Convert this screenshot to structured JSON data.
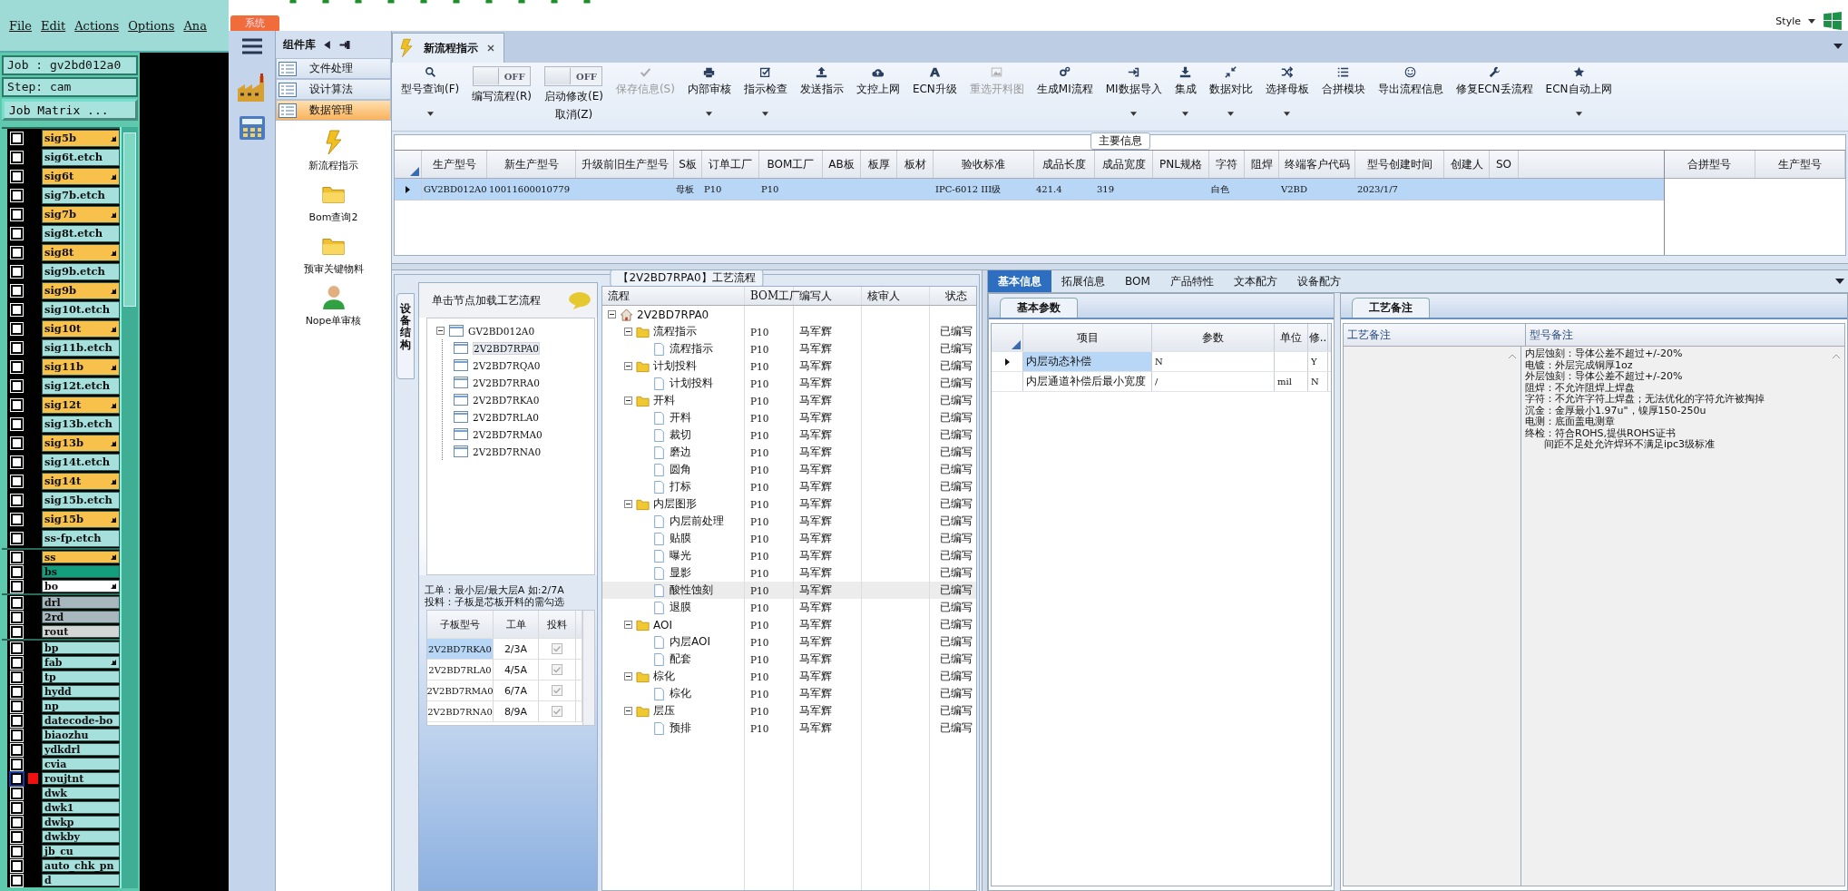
{
  "left_app": {
    "menu": [
      "File",
      "Edit",
      "Actions",
      "Options",
      "Ana"
    ],
    "job": "Job : gv2bd012a0",
    "step": "Step: cam",
    "matrix_button": "Job Matrix ...",
    "layer_groups": [
      {
        "compact": false,
        "layers": [
          {
            "name": "sig5b",
            "kind": "signal",
            "flag": true,
            "selected": false
          },
          {
            "name": "sig6t.etch",
            "kind": "etch",
            "flag": false,
            "selected": false
          },
          {
            "name": "sig6t",
            "kind": "signal",
            "flag": true,
            "selected": false
          },
          {
            "name": "sig7b.etch",
            "kind": "etch",
            "flag": false,
            "selected": false
          },
          {
            "name": "sig7b",
            "kind": "signal",
            "flag": true,
            "selected": false
          },
          {
            "name": "sig8t.etch",
            "kind": "etch",
            "flag": false,
            "selected": false
          },
          {
            "name": "sig8t",
            "kind": "signal",
            "flag": true,
            "selected": false
          },
          {
            "name": "sig9b.etch",
            "kind": "etch",
            "flag": false,
            "selected": false
          },
          {
            "name": "sig9b",
            "kind": "signal",
            "flag": true,
            "selected": false
          },
          {
            "name": "sig10t.etch",
            "kind": "etch",
            "flag": false,
            "selected": false
          },
          {
            "name": "sig10t",
            "kind": "signal",
            "flag": true,
            "selected": false
          },
          {
            "name": "sig11b.etch",
            "kind": "etch",
            "flag": false,
            "selected": false
          },
          {
            "name": "sig11b",
            "kind": "signal",
            "flag": true,
            "selected": false
          },
          {
            "name": "sig12t.etch",
            "kind": "etch",
            "flag": false,
            "selected": false
          },
          {
            "name": "sig12t",
            "kind": "signal",
            "flag": true,
            "selected": false
          },
          {
            "name": "sig13b.etch",
            "kind": "etch",
            "flag": false,
            "selected": false
          },
          {
            "name": "sig13b",
            "kind": "signal",
            "flag": true,
            "selected": false
          },
          {
            "name": "sig14t.etch",
            "kind": "etch",
            "flag": false,
            "selected": false
          },
          {
            "name": "sig14t",
            "kind": "signal",
            "flag": true,
            "selected": false
          },
          {
            "name": "sig15b.etch",
            "kind": "etch",
            "flag": false,
            "selected": false
          },
          {
            "name": "sig15b",
            "kind": "signal",
            "flag": true,
            "selected": false
          },
          {
            "name": "ss-fp.etch",
            "kind": "etch",
            "flag": false,
            "selected": false
          }
        ]
      },
      {
        "compact": true,
        "layers": [
          {
            "name": "ss",
            "kind": "signal",
            "flag": true,
            "selected": false
          },
          {
            "name": "bs",
            "kind": "mask",
            "flag": false,
            "selected": false
          },
          {
            "name": "bo",
            "kind": "silk",
            "flag": true,
            "selected": false
          }
        ]
      },
      {
        "compact": true,
        "layers": [
          {
            "name": "drl",
            "kind": "drill",
            "flag": false,
            "selected": false
          },
          {
            "name": "2rd",
            "kind": "drill",
            "flag": false,
            "selected": false
          },
          {
            "name": "rout",
            "kind": "rout",
            "flag": false,
            "selected": false
          }
        ]
      },
      {
        "compact": true,
        "layers": [
          {
            "name": "bp",
            "kind": "doc",
            "flag": false,
            "selected": false
          },
          {
            "name": "fab",
            "kind": "doc",
            "flag": true,
            "selected": false
          },
          {
            "name": "tp",
            "kind": "doc",
            "flag": false,
            "selected": false
          },
          {
            "name": "hydd",
            "kind": "doc",
            "flag": false,
            "selected": false
          },
          {
            "name": "np",
            "kind": "doc",
            "flag": false,
            "selected": false
          },
          {
            "name": "datecode-bo",
            "kind": "doc",
            "flag": false,
            "selected": false
          },
          {
            "name": "biaozhu",
            "kind": "doc",
            "flag": false,
            "selected": false
          },
          {
            "name": "ydkdrl",
            "kind": "doc",
            "flag": false,
            "selected": false
          },
          {
            "name": "cvia",
            "kind": "doc",
            "flag": false,
            "selected": false
          },
          {
            "name": "roujtnt",
            "kind": "doc",
            "flag": false,
            "selected": true
          },
          {
            "name": "dwk",
            "kind": "doc",
            "flag": false,
            "selected": false
          },
          {
            "name": "dwk1",
            "kind": "doc",
            "flag": false,
            "selected": false
          },
          {
            "name": "dwkp",
            "kind": "doc",
            "flag": false,
            "selected": false
          },
          {
            "name": "dwkby",
            "kind": "doc",
            "flag": false,
            "selected": false
          },
          {
            "name": "jb_cu",
            "kind": "doc",
            "flag": false,
            "selected": false
          },
          {
            "name": "auto_chk_pn",
            "kind": "doc",
            "flag": false,
            "selected": false
          },
          {
            "name": "d",
            "kind": "doc",
            "flag": false,
            "selected": false
          }
        ]
      }
    ]
  },
  "app": {
    "system_tab": "系统",
    "style": "Style",
    "nav_header": "组件库",
    "nav_items": [
      {
        "label": "文件处理",
        "selected": false
      },
      {
        "label": "设计算法",
        "selected": false
      },
      {
        "label": "数据管理",
        "selected": true
      }
    ],
    "nav_tools": [
      {
        "label": "新流程指示",
        "kind": "bolt"
      },
      {
        "label": "Bom查询2",
        "kind": "folder"
      },
      {
        "label": "预审关键物料",
        "kind": "folder"
      },
      {
        "label": "Nope单审核",
        "kind": "person"
      }
    ],
    "doc_tab": "新流程指示",
    "ribbon": [
      {
        "kind": "button",
        "label": "型号查询(F)",
        "dropdown": true,
        "disabled": false
      },
      {
        "kind": "toggle",
        "toggle": "OFF",
        "label": "编写流程(R)"
      },
      {
        "kind": "toggle",
        "toggle": "OFF",
        "label": "启动修改(E)",
        "label2": "取消(Z)"
      },
      {
        "kind": "button",
        "label": "保存信息(S)",
        "dropdown": false,
        "disabled": true
      },
      {
        "kind": "button",
        "label": "内部审核",
        "dropdown": true,
        "disabled": false
      },
      {
        "kind": "button",
        "label": "指示检查",
        "dropdown": true,
        "disabled": false
      },
      {
        "kind": "button",
        "label": "发送指示",
        "dropdown": false,
        "disabled": false
      },
      {
        "kind": "button",
        "label": "文控上网",
        "dropdown": false,
        "disabled": false
      },
      {
        "kind": "button",
        "label": "ECN升级",
        "dropdown": false,
        "disabled": false
      },
      {
        "kind": "button",
        "label": "重选开料图",
        "dropdown": false,
        "disabled": true
      },
      {
        "kind": "button",
        "label": "生成MI流程",
        "dropdown": false,
        "disabled": false
      },
      {
        "kind": "button",
        "label": "MI数据导入",
        "dropdown": true,
        "disabled": false
      },
      {
        "kind": "button",
        "label": "集成",
        "dropdown": true,
        "disabled": false
      },
      {
        "kind": "button",
        "label": "数据对比",
        "dropdown": true,
        "disabled": false
      },
      {
        "kind": "button",
        "label": "选择母板",
        "dropdown": true,
        "disabled": false
      },
      {
        "kind": "button",
        "label": "合拼模块",
        "dropdown": false,
        "disabled": false
      },
      {
        "kind": "button",
        "label": "导出流程信息",
        "dropdown": false,
        "disabled": false
      },
      {
        "kind": "button",
        "label": "修复ECN丢流程",
        "dropdown": false,
        "disabled": false
      },
      {
        "kind": "button",
        "label": "ECN自动上网",
        "dropdown": true,
        "disabled": false
      }
    ]
  },
  "main_info": {
    "title": "主要信息",
    "columns": [
      "生产型号",
      "新生产型号",
      "升级前旧生产型号",
      "S板",
      "订单工厂",
      "BOM工厂",
      "AB板",
      "板厚",
      "板材",
      "验收标准",
      "成品长度",
      "成品宽度",
      "PNL规格",
      "字符",
      "阻焊",
      "终端客户代码",
      "型号创建时间",
      "创建人",
      "SO"
    ],
    "rows": [
      {
        "selected": true,
        "cells": [
          "GV2BD012A0",
          "10011600010779",
          "",
          "母板",
          "P10",
          "P10",
          "",
          "",
          "",
          "IPC-6012 III级",
          "421.4",
          "319",
          "",
          "白色",
          "",
          "V2BD",
          "2023/1/7",
          "",
          ""
        ]
      }
    ],
    "merge_columns": [
      "合拼型号",
      "生产型号"
    ]
  },
  "process": {
    "title": "【2V2BD7RPA0】工艺流程",
    "side_tab": "设备结构",
    "hint_header": "单击节点加载工艺流程",
    "board_tree": {
      "label": "GV2BD012A0",
      "expanded": true,
      "children": [
        {
          "label": "2V2BD7RPA0",
          "selected": true
        },
        {
          "label": "2V2BD7RQA0",
          "selected": false
        },
        {
          "label": "2V2BD7RRA0",
          "selected": false
        },
        {
          "label": "2V2BD7RKA0",
          "selected": false
        },
        {
          "label": "2V2BD7RLA0",
          "selected": false
        },
        {
          "label": "2V2BD7RMA0",
          "selected": false
        },
        {
          "label": "2V2BD7RNA0",
          "selected": false
        }
      ]
    },
    "notes": [
      "工单：最小层/最大层A 如:2/7A",
      "投料：子板是芯板开料的需勾选"
    ],
    "sub_table": {
      "columns": [
        "子板型号",
        "工单",
        "投料"
      ],
      "rows": [
        {
          "cells": [
            "2V2BD7RKA0",
            "2/3A"
          ],
          "checked": true,
          "selected": true
        },
        {
          "cells": [
            "2V2BD7RLA0",
            "4/5A"
          ],
          "checked": true,
          "selected": false
        },
        {
          "cells": [
            "2V2BD7RMA0",
            "6/7A"
          ],
          "checked": true,
          "selected": false
        },
        {
          "cells": [
            "2V2BD7RNA0",
            "8/9A"
          ],
          "checked": true,
          "selected": false
        }
      ]
    },
    "flow_columns": [
      "流程",
      "BOM工厂",
      "编写人",
      "核审人",
      "状态"
    ],
    "flow_root": {
      "label": "2V2BD7RPA0",
      "kind": "home",
      "expanded": true,
      "selected": false,
      "children": [
        {
          "label": "流程指示",
          "kind": "folder",
          "expanded": true,
          "factory": "P10",
          "writer": "马军辉",
          "status": "已编写",
          "selected": false,
          "children": [
            {
              "label": "流程指示",
              "kind": "file",
              "factory": "P10",
              "writer": "马军辉",
              "status": "已编写",
              "selected": false
            }
          ]
        },
        {
          "label": "计划投料",
          "kind": "folder",
          "expanded": true,
          "factory": "P10",
          "writer": "马军辉",
          "status": "已编写",
          "selected": false,
          "children": [
            {
              "label": "计划投料",
              "kind": "file",
              "factory": "P10",
              "writer": "马军辉",
              "status": "已编写",
              "selected": false
            }
          ]
        },
        {
          "label": "开料",
          "kind": "folder",
          "expanded": true,
          "factory": "P10",
          "writer": "马军辉",
          "status": "已编写",
          "selected": false,
          "children": [
            {
              "label": "开料",
              "kind": "file",
              "factory": "P10",
              "writer": "马军辉",
              "status": "已编写",
              "selected": false
            },
            {
              "label": "裁切",
              "kind": "file",
              "factory": "P10",
              "writer": "马军辉",
              "status": "已编写",
              "selected": false
            },
            {
              "label": "磨边",
              "kind": "file",
              "factory": "P10",
              "writer": "马军辉",
              "status": "已编写",
              "selected": false
            },
            {
              "label": "圆角",
              "kind": "file",
              "factory": "P10",
              "writer": "马军辉",
              "status": "已编写",
              "selected": false
            },
            {
              "label": "打标",
              "kind": "file",
              "factory": "P10",
              "writer": "马军辉",
              "status": "已编写",
              "selected": false
            }
          ]
        },
        {
          "label": "内层图形",
          "kind": "folder",
          "expanded": true,
          "factory": "P10",
          "writer": "马军辉",
          "status": "已编写",
          "selected": false,
          "children": [
            {
              "label": "内层前处理",
              "kind": "file",
              "factory": "P10",
              "writer": "马军辉",
              "status": "已编写",
              "selected": false
            },
            {
              "label": "贴膜",
              "kind": "file",
              "factory": "P10",
              "writer": "马军辉",
              "status": "已编写",
              "selected": false
            },
            {
              "label": "曝光",
              "kind": "file",
              "factory": "P10",
              "writer": "马军辉",
              "status": "已编写",
              "selected": false
            },
            {
              "label": "显影",
              "kind": "file",
              "factory": "P10",
              "writer": "马军辉",
              "status": "已编写",
              "selected": false
            },
            {
              "label": "酸性蚀刻",
              "kind": "file",
              "factory": "P10",
              "writer": "马军辉",
              "status": "已编写",
              "selected": true
            },
            {
              "label": "退膜",
              "kind": "file",
              "factory": "P10",
              "writer": "马军辉",
              "status": "已编写",
              "selected": false
            }
          ]
        },
        {
          "label": "AOI",
          "kind": "folder",
          "expanded": true,
          "factory": "P10",
          "writer": "马军辉",
          "status": "已编写",
          "selected": false,
          "children": [
            {
              "label": "内层AOI",
              "kind": "file",
              "factory": "P10",
              "writer": "马军辉",
              "status": "已编写",
              "selected": false
            },
            {
              "label": "配套",
              "kind": "file",
              "factory": "P10",
              "writer": "马军辉",
              "status": "已编写",
              "selected": false
            }
          ]
        },
        {
          "label": "棕化",
          "kind": "folder",
          "expanded": true,
          "factory": "P10",
          "writer": "马军辉",
          "status": "已编写",
          "selected": false,
          "children": [
            {
              "label": "棕化",
              "kind": "file",
              "factory": "P10",
              "writer": "马军辉",
              "status": "已编写",
              "selected": false
            }
          ]
        },
        {
          "label": "层压",
          "kind": "folder",
          "expanded": true,
          "factory": "P10",
          "writer": "马军辉",
          "status": "已编写",
          "selected": false,
          "children": [
            {
              "label": "预排",
              "kind": "file",
              "factory": "P10",
              "writer": "马军辉",
              "status": "已编写",
              "selected": false
            }
          ]
        }
      ]
    }
  },
  "detail": {
    "tabs": [
      {
        "label": "基本信息",
        "selected": true
      },
      {
        "label": "拓展信息",
        "selected": false
      },
      {
        "label": "BOM",
        "selected": false
      },
      {
        "label": "产品特性",
        "selected": false
      },
      {
        "label": "文本配方",
        "selected": false
      },
      {
        "label": "设备配方",
        "selected": false
      }
    ],
    "params": {
      "tab": "基本参数",
      "columns": [
        "项目",
        "参数",
        "单位",
        "修.."
      ],
      "rows": [
        {
          "cells": [
            "内层动态补偿",
            "N",
            "",
            "Y"
          ],
          "selected": true
        },
        {
          "cells": [
            "内层通道补偿后最小宽度",
            "/",
            "mil",
            "N"
          ],
          "selected": false
        }
      ]
    },
    "remarks": {
      "tab": "工艺备注",
      "columns": [
        "工艺备注",
        "型号备注"
      ],
      "lines": [
        "内层蚀刻：导体公差不超过+/-20%",
        "电镀：外层完成铜厚1oz",
        "外层蚀刻：导体公差不超过+/-20%",
        "阻焊：不允许阻焊上焊盘",
        "字符：不允许字符上焊盘；无法优化的字符允许被掏掉",
        "沉金：金厚最小1.97u\"，镍厚150-250u",
        "电测：底面盖电测章",
        "终检：符合ROHS,提供ROHS证书",
        "      间距不足处允许焊环不满足ipc3级标准"
      ]
    }
  }
}
